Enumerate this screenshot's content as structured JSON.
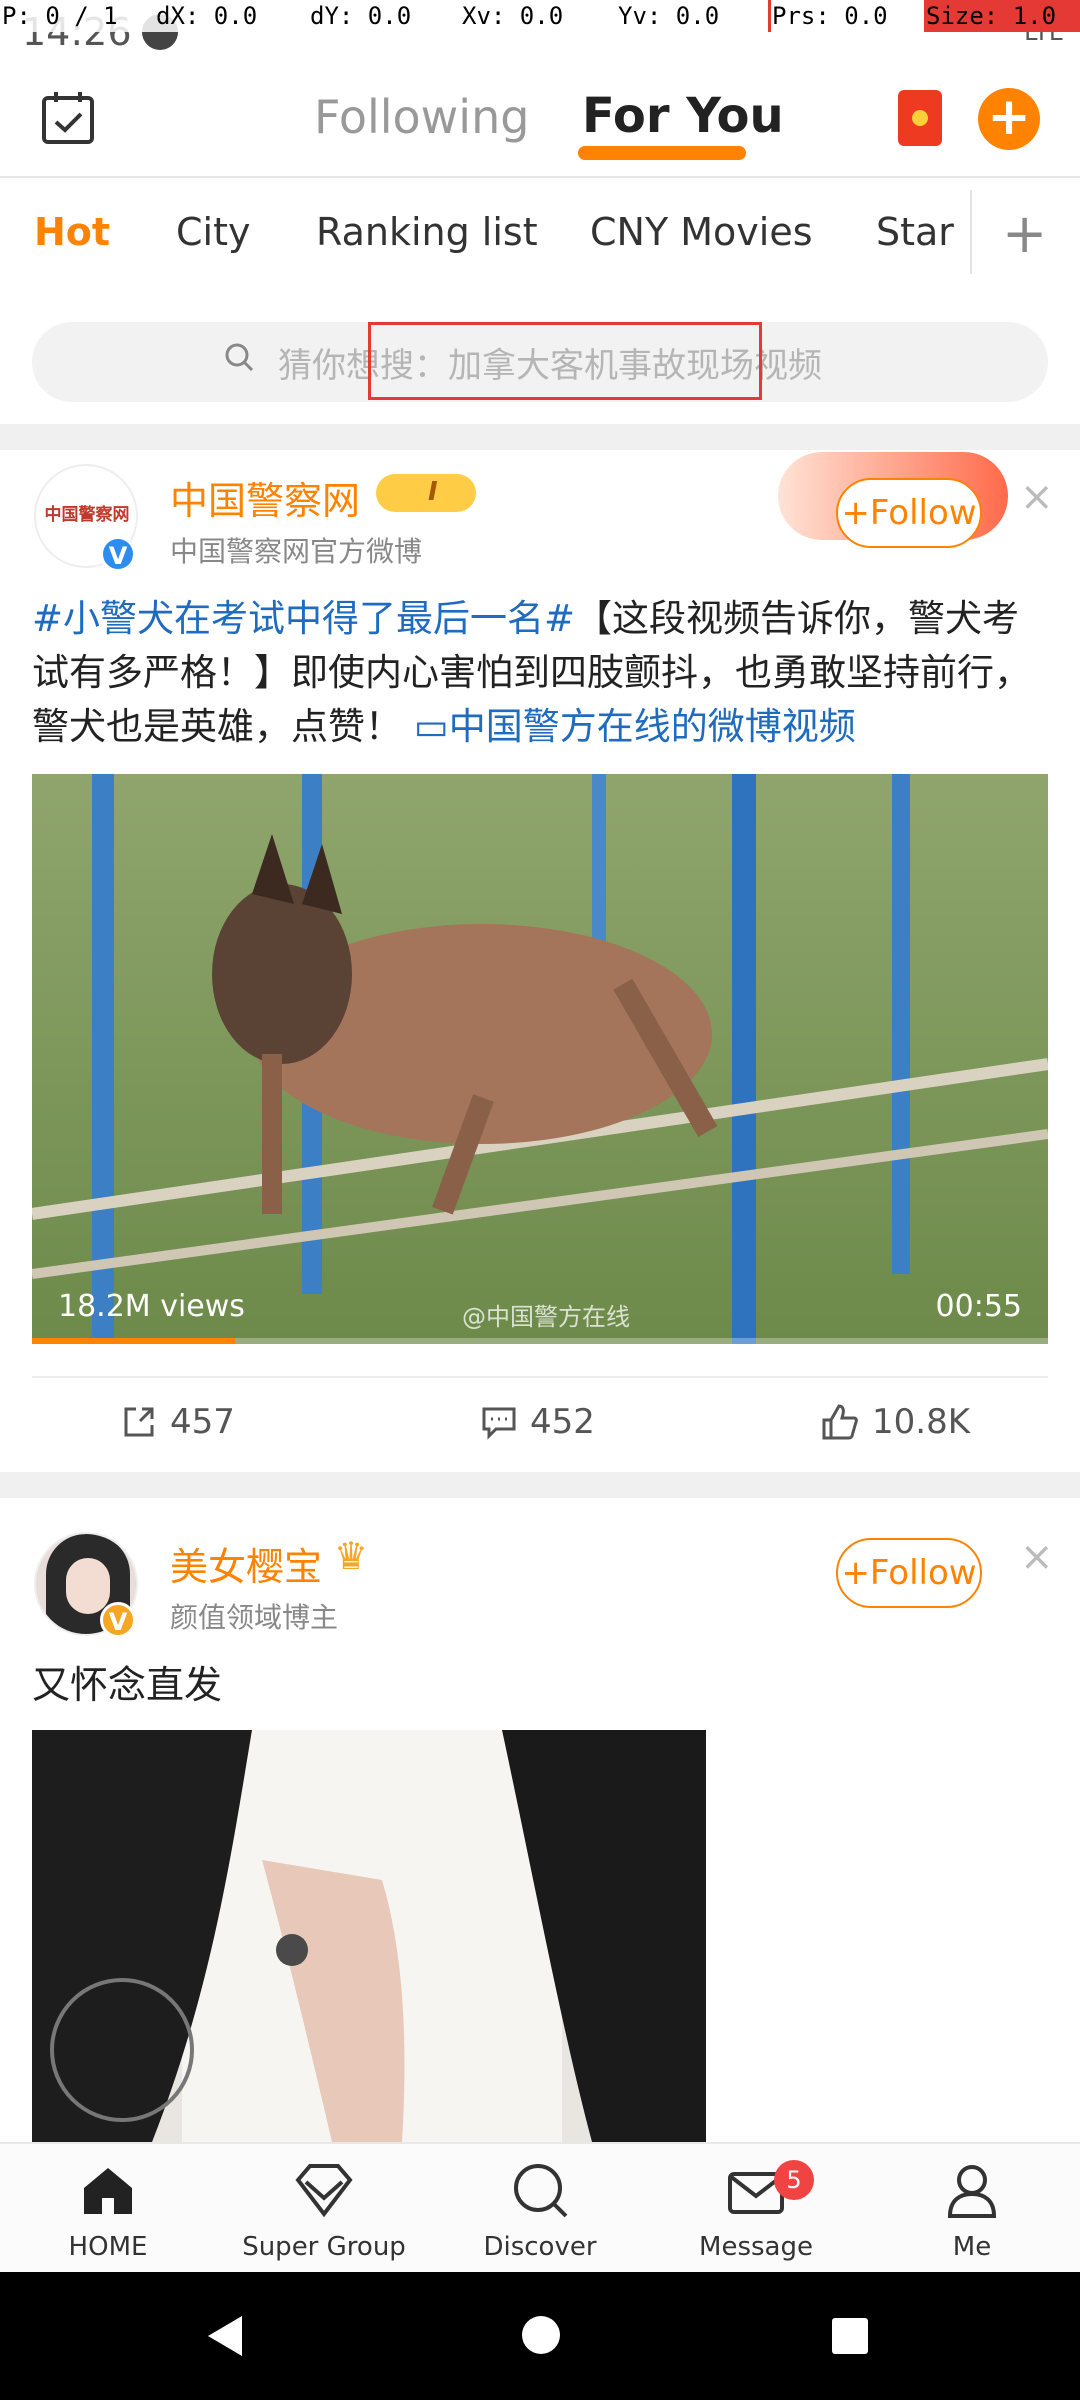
{
  "debug": {
    "p": "P: 0 / 1",
    "dx": "dX: 0.0",
    "dy": "dY: 0.0",
    "xv": "Xv: 0.0",
    "yv": "Yv: 0.0",
    "prs": "Prs: 0.0",
    "size": "Size: 1.0"
  },
  "status": {
    "time": "14:26",
    "network": "LTE"
  },
  "header": {
    "tabs": [
      {
        "label": "Following",
        "active": false
      },
      {
        "label": "For You",
        "active": true
      }
    ]
  },
  "categories": {
    "items": [
      {
        "label": "Hot",
        "active": true
      },
      {
        "label": "City"
      },
      {
        "label": "Ranking list"
      },
      {
        "label": "CNY Movies"
      },
      {
        "label": "Star"
      }
    ],
    "add_label": "+"
  },
  "search": {
    "placeholder": "猜你想搜：加拿大客机事故现场视频"
  },
  "post1": {
    "author": "中国警察网",
    "level": "I",
    "subtitle": "中国警察网官方微博",
    "avatar_text": "中国警察网",
    "follow_label": "Follow",
    "close": "×",
    "topic": "#小警犬在考试中得了最后一名#",
    "body": "【这段视频告诉你，警犬考试有多严格！】即使内心害怕到四肢颤抖，也勇敢坚持前行，警犬也是英雄，点赞！",
    "video_link": "中国警方在线的微博视频",
    "video": {
      "views": "18.2M views",
      "watermark": "@中国警方在线",
      "duration": "00:55",
      "progress": 0.2
    },
    "actions": {
      "share": "457",
      "comments": "452",
      "likes": "10.8K"
    }
  },
  "post2": {
    "author": "美女樱宝",
    "subtitle": "颜值领域博主",
    "follow_label": "Follow",
    "close": "×",
    "text": "又怀念直发"
  },
  "bottom_nav": {
    "items": [
      {
        "label": "HOME",
        "icon": "home-icon"
      },
      {
        "label": "Super Group",
        "icon": "diamond-icon"
      },
      {
        "label": "Discover",
        "icon": "search-icon"
      },
      {
        "label": "Message",
        "icon": "mail-icon",
        "badge": "5"
      },
      {
        "label": "Me",
        "icon": "person-icon"
      }
    ]
  },
  "colors": {
    "accent": "#ff8200",
    "link": "#1f6bbf",
    "badge": "#f04443"
  }
}
